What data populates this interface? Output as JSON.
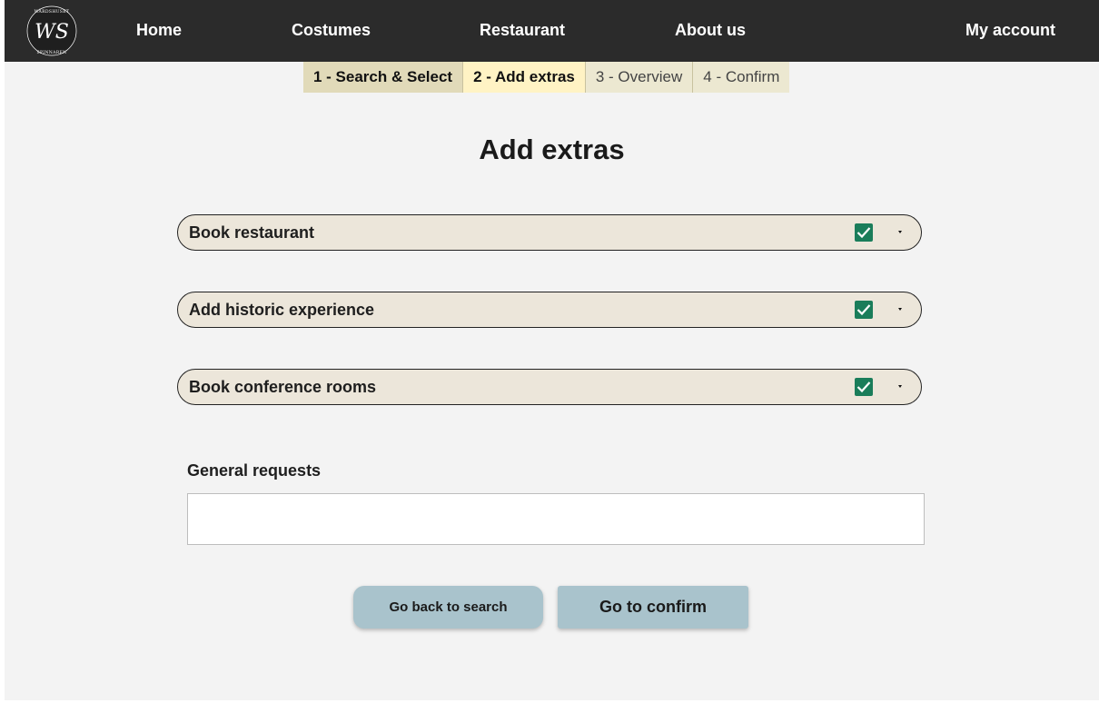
{
  "brand": {
    "monogram": "WS",
    "top_text": "WÄRDSHUSET",
    "bottom_text": "SPINNAREN"
  },
  "nav": {
    "home": "Home",
    "costumes": "Costumes",
    "restaurant": "Restaurant",
    "about": "About us",
    "account": "My account"
  },
  "steps": [
    {
      "label": "1 - Search & Select",
      "state": "done"
    },
    {
      "label": "2 - Add extras",
      "state": "active"
    },
    {
      "label": "3 - Overview",
      "state": "todo"
    },
    {
      "label": "4 - Confirm",
      "state": "todo"
    }
  ],
  "page_title": "Add extras",
  "extras": [
    {
      "label": "Book restaurant",
      "checked": true
    },
    {
      "label": "Add historic experience",
      "checked": true
    },
    {
      "label": "Book conference rooms",
      "checked": true
    }
  ],
  "requests": {
    "label": "General requests",
    "value": "",
    "placeholder": ""
  },
  "buttons": {
    "back": "Go back to search",
    "confirm": "Go to confirm"
  },
  "colors": {
    "navbar": "#2b2b2b",
    "checkbox": "#1a7d5a",
    "step_active": "#fff3c4",
    "step_done": "#e1dab9",
    "accordion": "#ece6da",
    "button": "#a9c3cc"
  },
  "icons": {
    "checkbox": "checkmark-icon",
    "toggle": "chevron-down-icon"
  }
}
